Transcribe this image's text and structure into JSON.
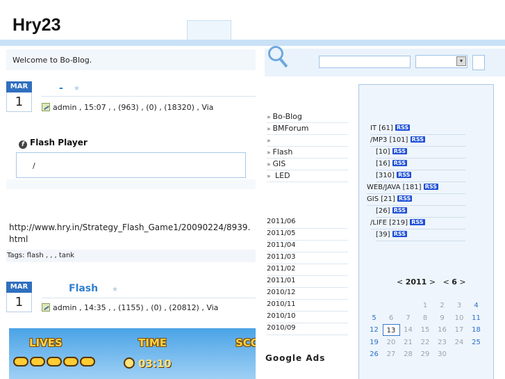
{
  "site": {
    "title": "Hry23",
    "welcome": "Welcome to Bo-Blog."
  },
  "posts": [
    {
      "month": "MAR",
      "day": "1",
      "title": "-",
      "meta": "admin , 15:07 ,    ,  (963) ,  (0) ,  (18320) , Via"
    },
    {
      "month": "MAR",
      "day": "1",
      "title": "Flash",
      "meta": "admin , 14:35 ,    ,  (1155) ,  (0) ,  (20812) , Via"
    }
  ],
  "flash_player": {
    "title": "Flash Player",
    "box_text": "/"
  },
  "post_url": "http://www.hry.in/Strategy_Flash_Game1/20090224/8939.html",
  "tags": "Tags: flash ,   ,   , tank",
  "game_banner": {
    "lives_label": "LIVES",
    "time_label": "TIME",
    "score_label": "SCO",
    "time_value": "03:10"
  },
  "sidebar": {
    "links": [
      {
        "label": "Bo-Blog"
      },
      {
        "label": "BMForum"
      },
      {
        "label": ""
      },
      {
        "label": "Flash"
      },
      {
        "label": "GIS"
      },
      {
        "label": "  LED"
      }
    ],
    "archives": [
      "2011/06",
      "2011/05",
      "2011/04",
      "2011/03",
      "2011/02",
      "2011/01",
      "2010/12",
      "2010/11",
      "2010/10",
      "2010/09"
    ],
    "ads_title": "Google Ads",
    "categories": [
      {
        "label": "IT [61]",
        "indent": 0
      },
      {
        "label": "/MP3 [101]",
        "indent": 0
      },
      {
        "label": "  [10]",
        "indent": 1
      },
      {
        "label": "  [16]",
        "indent": 1
      },
      {
        "label": "  [310]",
        "indent": 1
      },
      {
        "label": "WEB/JAVA [181]",
        "indent": -1
      },
      {
        "label": "GIS [21]",
        "indent": -1
      },
      {
        "label": "  [26]",
        "indent": 1
      },
      {
        "label": "/LIFE [219]",
        "indent": 0
      },
      {
        "label": "  [39]",
        "indent": 1
      }
    ],
    "rss_label": "RSS"
  },
  "calendar": {
    "year_nav": "< 2011 >",
    "month_nav": "< 6 >",
    "year": "2011",
    "month": "6",
    "rows": [
      [
        "",
        "",
        "",
        "1",
        "2",
        "3",
        "4"
      ],
      [
        "5",
        "6",
        "7",
        "8",
        "9",
        "10",
        "11"
      ],
      [
        "12",
        "13",
        "14",
        "15",
        "16",
        "17",
        "18"
      ],
      [
        "19",
        "20",
        "21",
        "22",
        "23",
        "24",
        "25"
      ],
      [
        "26",
        "27",
        "28",
        "29",
        "30",
        "",
        ""
      ]
    ],
    "today": "13",
    "highlight": [
      "4",
      "5",
      "11",
      "12",
      "18",
      "19",
      "25",
      "26"
    ]
  }
}
